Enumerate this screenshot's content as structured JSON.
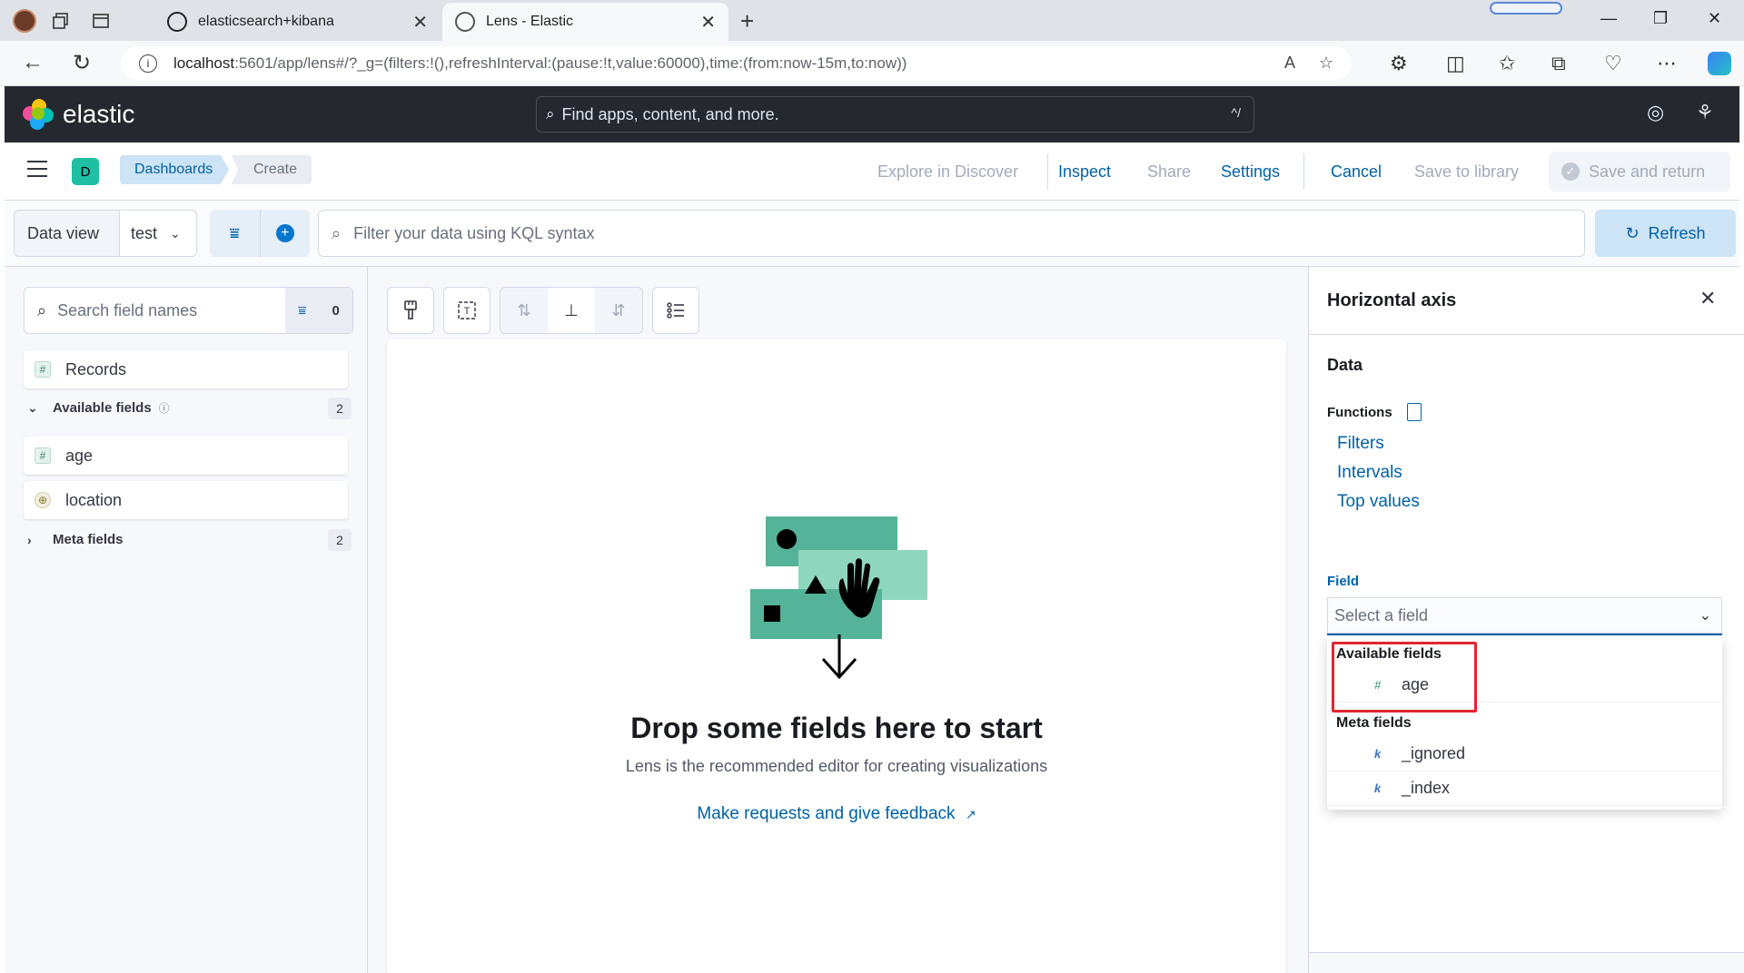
{
  "browser": {
    "tabs": [
      {
        "title": "elasticsearch+kibana",
        "active": false
      },
      {
        "title": "Lens - Elastic",
        "active": true
      }
    ],
    "url_host": "localhost",
    "url_path": ":5601/app/lens#/?_g=(filters:!(),refreshInterval:(pause:!t,value:60000),time:(from:now-15m,to:now))"
  },
  "kibana": {
    "brand": "elastic",
    "search_placeholder": "Find apps, content, and more.",
    "search_shortcut": "^/"
  },
  "appbar": {
    "space_initial": "D",
    "breadcrumbs": [
      "Dashboards",
      "Create"
    ],
    "explore_label": "Explore in Discover",
    "inspect_label": "Inspect",
    "share_label": "Share",
    "settings_label": "Settings",
    "cancel_label": "Cancel",
    "save_library_label": "Save to library",
    "save_return_label": "Save and return"
  },
  "querybar": {
    "data_view_label": "Data view",
    "data_view_value": "test",
    "kql_placeholder": "Filter your data using KQL syntax",
    "refresh_label": "Refresh"
  },
  "sidebar": {
    "search_placeholder": "Search field names",
    "filter_count": "0",
    "records_label": "Records",
    "available_label": "Available fields",
    "available_count": "2",
    "available_fields": [
      {
        "name": "age",
        "type": "#"
      },
      {
        "name": "location",
        "type": "geo"
      }
    ],
    "meta_label": "Meta fields",
    "meta_count": "2"
  },
  "workspace": {
    "empty_title": "Drop some fields here to start",
    "empty_subtitle": "Lens is the recommended editor for creating visualizations",
    "feedback_link": "Make requests and give feedback"
  },
  "flyout": {
    "title": "Horizontal axis",
    "data_label": "Data",
    "functions_label": "Functions",
    "functions": [
      "Filters",
      "Intervals",
      "Top values"
    ],
    "field_label": "Field",
    "field_placeholder": "Select a field",
    "dropdown": {
      "available_label": "Available fields",
      "available_items": [
        {
          "name": "age",
          "type": "#"
        }
      ],
      "meta_label": "Meta fields",
      "meta_items": [
        {
          "name": "_ignored",
          "type": "k"
        },
        {
          "name": "_index",
          "type": "k"
        }
      ]
    }
  },
  "colors": {
    "primary": "#0061a6",
    "header_bg": "#25282f",
    "highlight": "#e0262f",
    "illustration_green": "#54b399"
  }
}
